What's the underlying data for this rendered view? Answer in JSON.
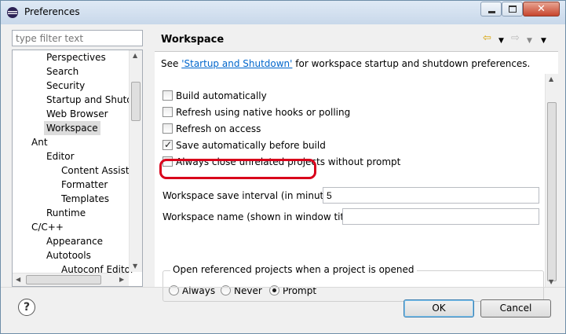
{
  "window": {
    "title": "Preferences"
  },
  "filter": {
    "placeholder": "type filter text"
  },
  "tree": {
    "items": [
      {
        "label": "Perspectives",
        "level": 2
      },
      {
        "label": "Search",
        "level": 2
      },
      {
        "label": "Security",
        "level": 2
      },
      {
        "label": "Startup and Shutdown",
        "level": 2
      },
      {
        "label": "Web Browser",
        "level": 2
      },
      {
        "label": "Workspace",
        "level": 2,
        "selected": true
      },
      {
        "label": "Ant",
        "level": 1
      },
      {
        "label": "Editor",
        "level": 2
      },
      {
        "label": "Content Assist",
        "level": 3
      },
      {
        "label": "Formatter",
        "level": 3
      },
      {
        "label": "Templates",
        "level": 3
      },
      {
        "label": "Runtime",
        "level": 2
      },
      {
        "label": "C/C++",
        "level": 1
      },
      {
        "label": "Appearance",
        "level": 2
      },
      {
        "label": "Autotools",
        "level": 2
      },
      {
        "label": "Autoconf Editor",
        "level": 3
      }
    ]
  },
  "page": {
    "title": "Workspace",
    "desc_prefix": "See ",
    "desc_link": "'Startup and Shutdown'",
    "desc_suffix": " for workspace startup and shutdown preferences.",
    "options": [
      {
        "label": "Build automatically",
        "checked": false
      },
      {
        "label": "Refresh using native hooks or polling",
        "checked": false
      },
      {
        "label": "Refresh on access",
        "checked": false
      },
      {
        "label": "Save automatically before build",
        "checked": true
      },
      {
        "label": "Always close unrelated projects without prompt",
        "checked": false
      }
    ],
    "save_interval_label": "Workspace save interval (in minutes):",
    "save_interval_value": "5",
    "workspace_name_label": "Workspace name (shown in window title):",
    "workspace_name_value": "",
    "group_label": "Open referenced projects when a project is opened",
    "radios": [
      {
        "label": "Always",
        "selected": false
      },
      {
        "label": "Never",
        "selected": false
      },
      {
        "label": "Prompt",
        "selected": true
      }
    ]
  },
  "buttons": {
    "ok": "OK",
    "cancel": "Cancel",
    "help": "?"
  },
  "colors": {
    "highlight": "#d9001b",
    "link": "#0066cc"
  }
}
